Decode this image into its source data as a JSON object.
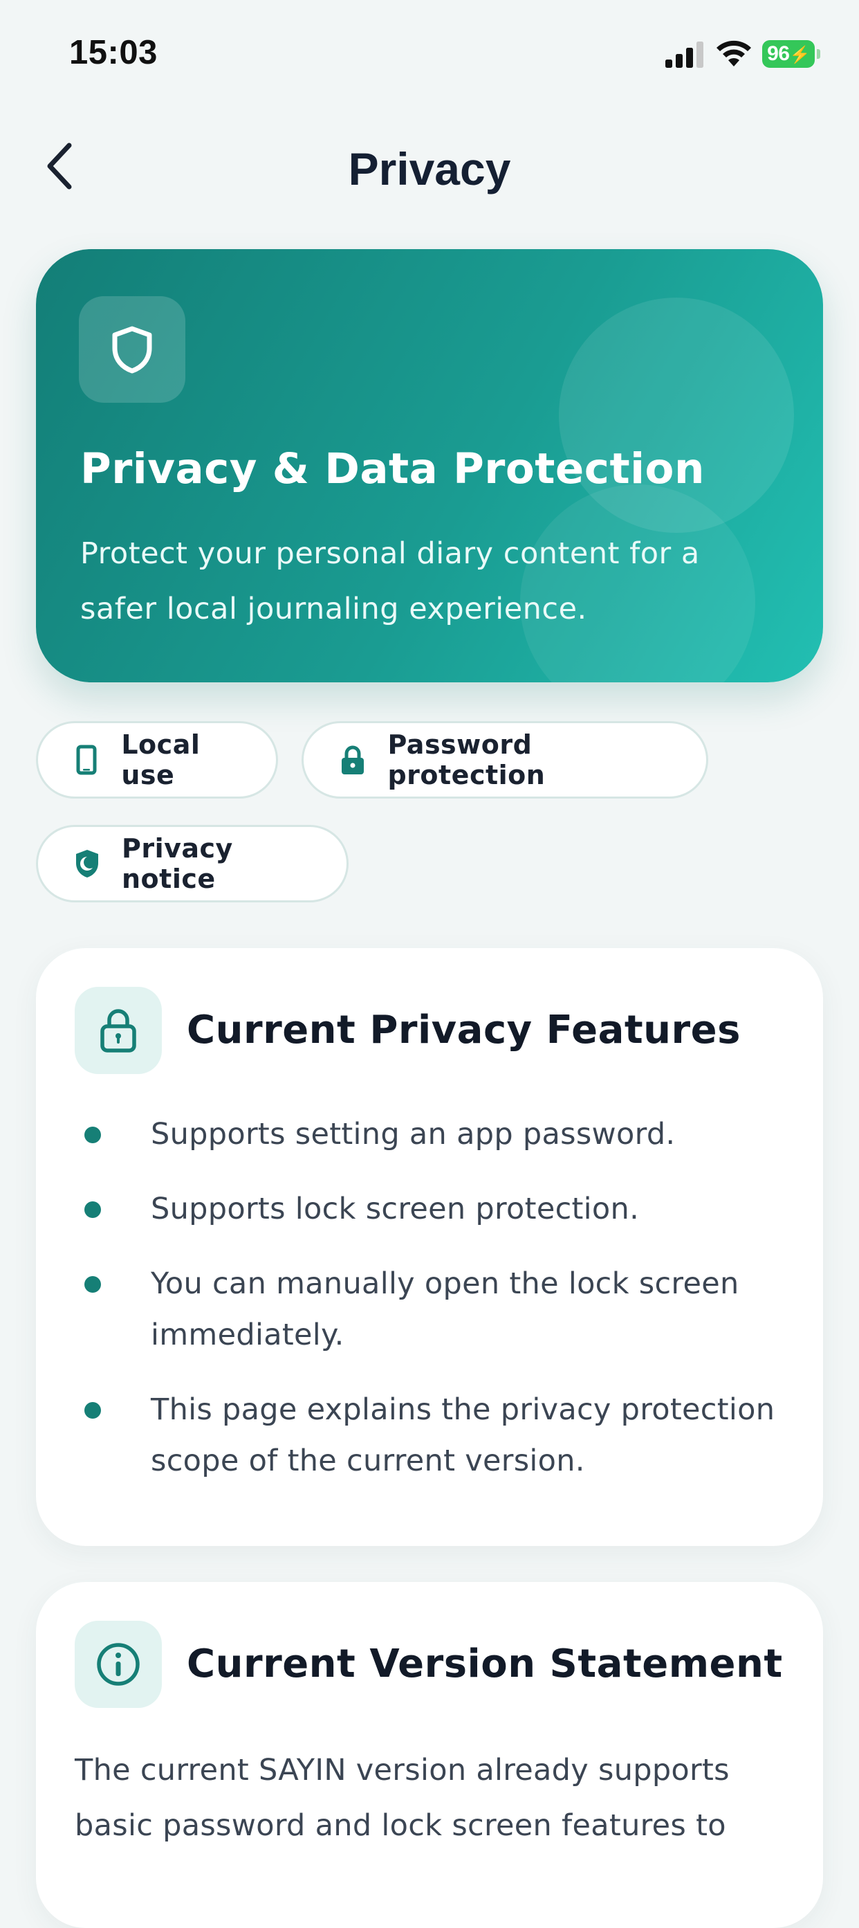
{
  "status_bar": {
    "time": "15:03",
    "battery": "96",
    "icons": [
      "cellular-signal-icon",
      "wifi-icon",
      "battery-charging-icon"
    ]
  },
  "nav": {
    "title": "Privacy",
    "back_icon": "chevron-left-icon"
  },
  "hero": {
    "icon": "shield-icon",
    "title": "Privacy & Data Protection",
    "description": "Protect your personal diary content for a safer local journaling experience."
  },
  "chips": [
    {
      "label": "Local use",
      "icon": "phone-icon"
    },
    {
      "label": "Password protection",
      "icon": "lock-icon"
    },
    {
      "label": "Privacy notice",
      "icon": "shield-half-icon"
    }
  ],
  "features_card": {
    "icon": "lock-icon",
    "title": "Current Privacy Features",
    "items": [
      "Supports setting an app password.",
      "Supports lock screen protection.",
      "You can manually open the lock screen immediately.",
      "This page explains the privacy protection scope of the current version."
    ]
  },
  "version_card": {
    "icon": "info-icon",
    "title": "Current Version Statement",
    "text": "The current SAYIN version already supports basic password and lock screen features to"
  },
  "colors": {
    "accent": "#167f76",
    "hero_gradient_start": "#137e77",
    "hero_gradient_end": "#22bfb2",
    "background": "#f2f6f6",
    "battery": "#34c759"
  }
}
